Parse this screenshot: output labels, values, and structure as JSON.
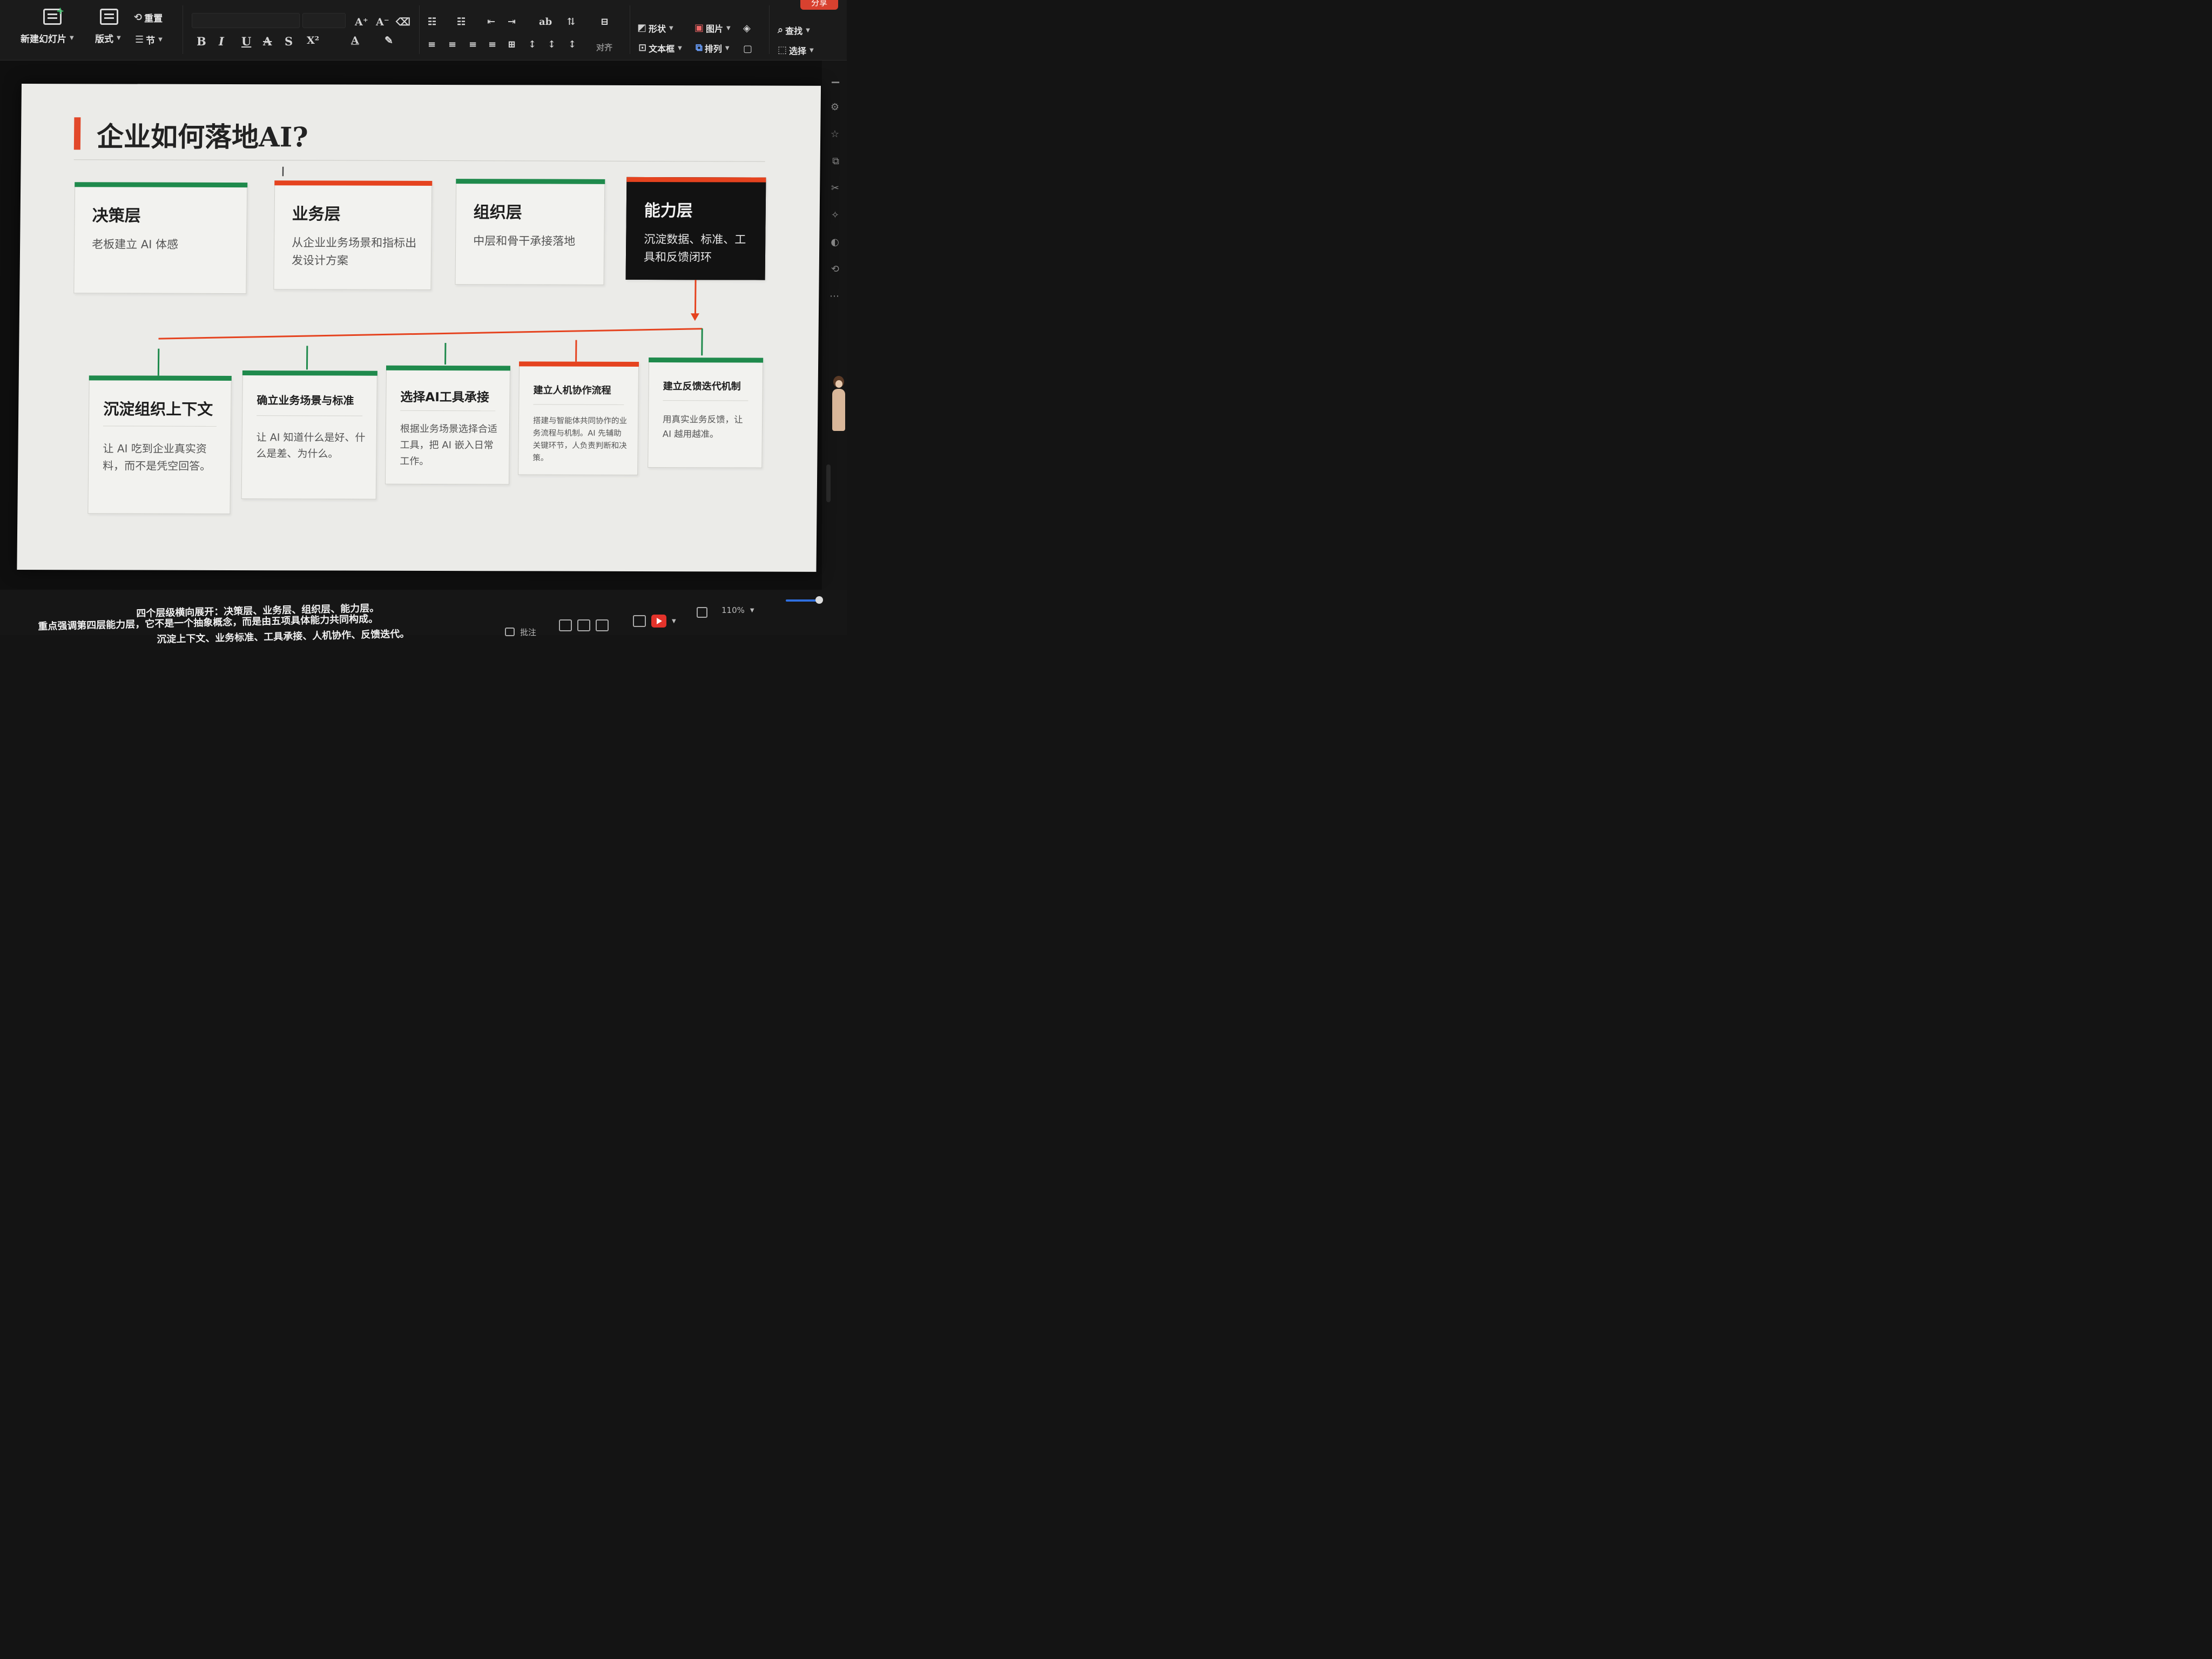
{
  "ribbon": {
    "new_slide": "新建幻灯片",
    "layout": "版式",
    "reset": "重置",
    "section": "节",
    "share": "分享",
    "align": "对齐",
    "shape": "形状",
    "image": "图片",
    "textbox": "文本框",
    "arrange": "排列",
    "find": "查找",
    "select": "选择",
    "format_buttons": [
      "B",
      "I",
      "U",
      "A",
      "S",
      "X²"
    ]
  },
  "slide": {
    "title": "企业如何落地AI?",
    "layers": [
      {
        "title": "决策层",
        "desc": "老板建立 AI 体感",
        "accent": "#1f8a4c"
      },
      {
        "title": "业务层",
        "desc": "从企业业务场景和指标出发设计方案",
        "accent": "#e5431f"
      },
      {
        "title": "组织层",
        "desc": "中层和骨干承接落地",
        "accent": "#1f8a4c"
      },
      {
        "title": "能力层",
        "desc": "沉淀数据、标准、工具和反馈闭环",
        "accent": "#e5431f"
      }
    ],
    "capabilities": [
      {
        "title": "沉淀组织上下文",
        "desc": "让 AI 吃到企业真实资料，而不是凭空回答。",
        "accent": "#1f8a4c"
      },
      {
        "title": "确立业务场景与标准",
        "desc": "让 AI 知道什么是好、什么是差、为什么。",
        "accent": "#1f8a4c"
      },
      {
        "title": "选择AI工具承接",
        "desc": "根据业务场景选择合适工具，把 AI 嵌入日常工作。",
        "accent": "#1f8a4c"
      },
      {
        "title": "建立人机协作流程",
        "desc": "搭建与智能体共同协作的业务流程与机制。AI 先辅助关键环节，人负责判断和决策。",
        "accent": "#e5431f"
      },
      {
        "title": "建立反馈迭代机制",
        "desc": "用真实业务反馈，让 AI 越用越准。",
        "accent": "#1f8a4c"
      }
    ]
  },
  "notes": {
    "line1": "四个层级横向展开：决策层、业务层、组织层、能力层。",
    "line2": "重点强调第四层能力层，它不是一个抽象概念，而是由五项具体能力共同构成。",
    "line3": "沉淀上下文、业务标准、工具承接、人机协作、反馈迭代。"
  },
  "status": {
    "comment": "批注",
    "zoom": "110%"
  }
}
